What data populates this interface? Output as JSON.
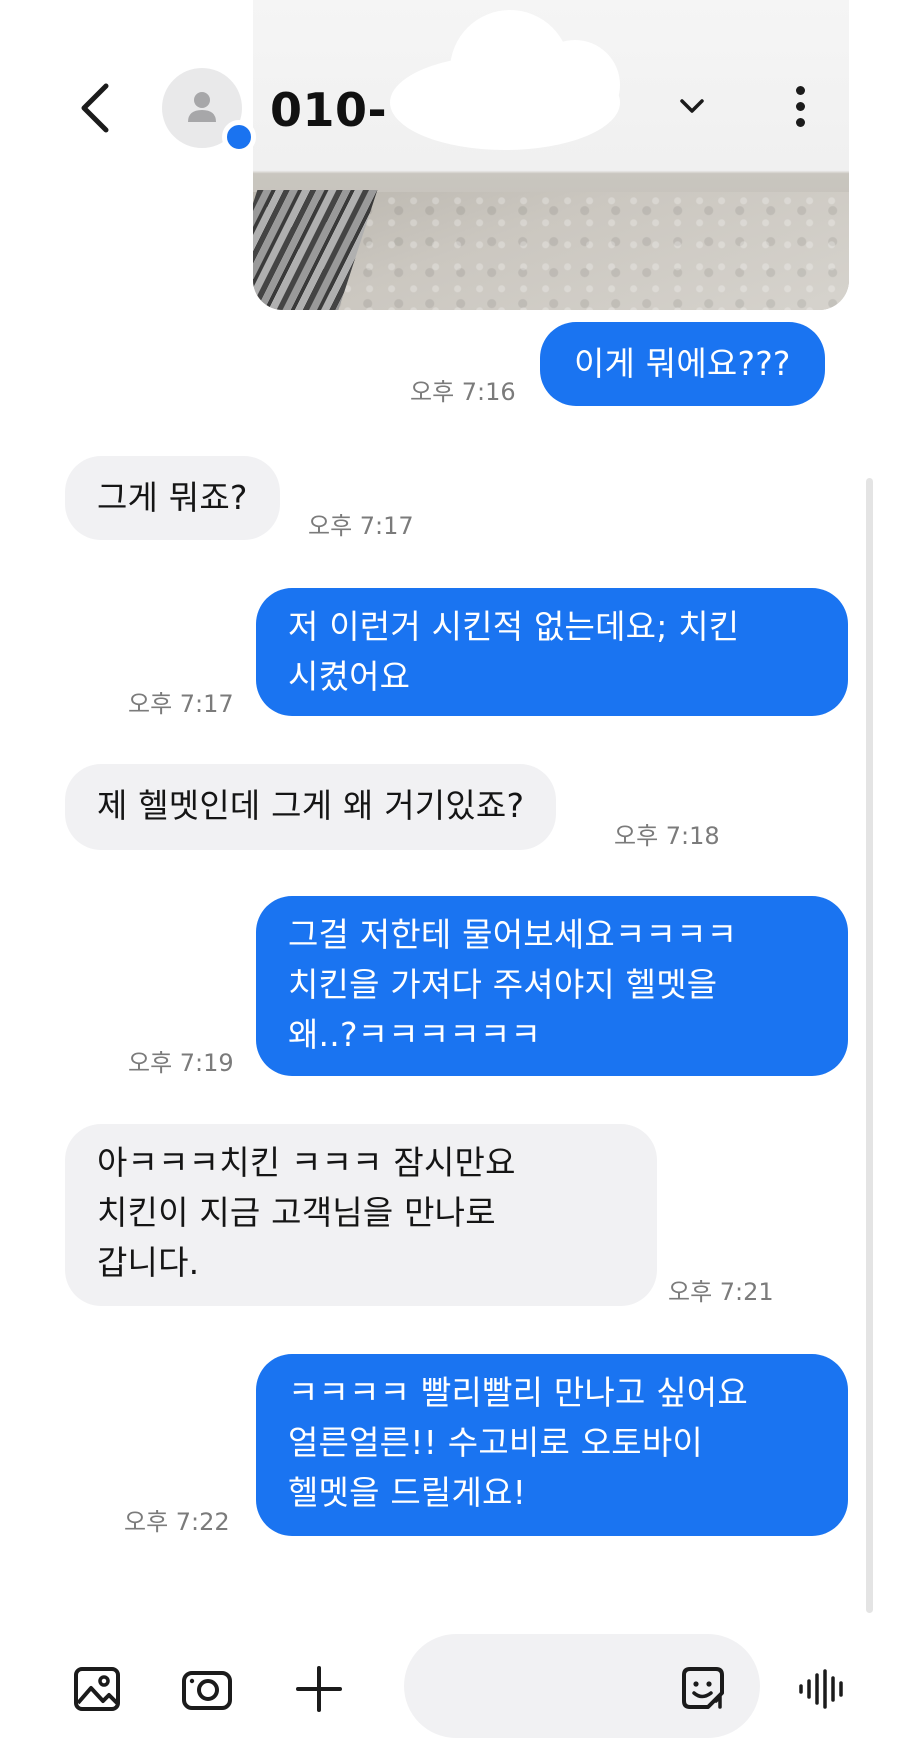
{
  "header": {
    "title": "010-",
    "back_icon": "chevron-left-icon",
    "avatar_icon": "person-icon",
    "dropdown_icon": "chevron-down-icon",
    "more_icon": "more-vertical-icon",
    "accent": "#1a73f0"
  },
  "messages": [
    {
      "dir": "out",
      "text": "이게 뭐에요???",
      "time": "오후 7:16"
    },
    {
      "dir": "in",
      "text": "그게 뭐죠?",
      "time": "오후 7:17"
    },
    {
      "dir": "out",
      "text": "저 이런거 시킨적 없는데요; 치킨\n시켰어요",
      "time": "오후 7:17"
    },
    {
      "dir": "in",
      "text": "제 헬멧인데 그게 왜 거기있죠?",
      "time": "오후 7:18"
    },
    {
      "dir": "out",
      "text": "그걸 저한테 물어보세요ㅋㅋㅋㅋ\n치킨을 가져다 주셔야지 헬멧을\n왜..?ㅋㅋㅋㅋㅋㅋ",
      "time": "오후 7:19"
    },
    {
      "dir": "in",
      "text": "아ㅋㅋㅋ치킨 ㅋㅋㅋ 잠시만요\n치킨이 지금 고객님을 만나로\n갑니다.",
      "time": "오후 7:21"
    },
    {
      "dir": "out",
      "text": "ㅋㅋㅋㅋ 빨리빨리 만나고 싶어요\n얼른얼른!! 수고비로 오토바이\n헬멧을 드릴게요!",
      "time": "오후 7:22"
    }
  ],
  "composer": {
    "gallery_icon": "image-icon",
    "camera_icon": "camera-icon",
    "add_icon": "plus-icon",
    "sticker_icon": "sticker-icon",
    "voice_icon": "voice-wave-icon"
  }
}
